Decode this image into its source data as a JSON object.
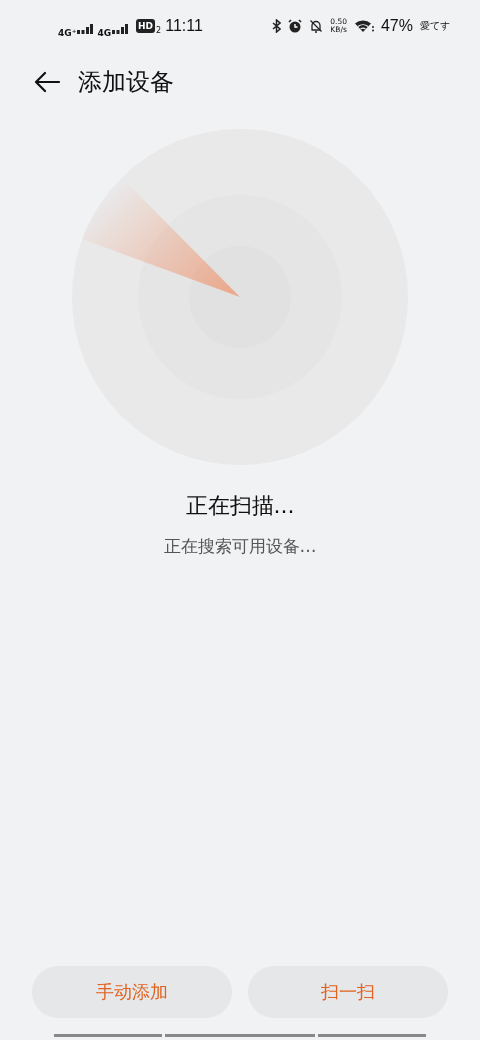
{
  "status_bar": {
    "sim_1": "4G⁺",
    "sim_2": "4G",
    "hd_label": "HD",
    "hd_sub": "2",
    "time": "11:11",
    "speed_value": "0.50",
    "speed_unit": "KB/s",
    "battery": "47%",
    "carrier_note": "愛てす"
  },
  "header": {
    "title": "添加设备"
  },
  "scan": {
    "title": "正在扫描...",
    "subtitle": "正在搜索可用设备…"
  },
  "buttons": [
    {
      "label": "手动添加"
    },
    {
      "label": "扫一扫"
    }
  ]
}
